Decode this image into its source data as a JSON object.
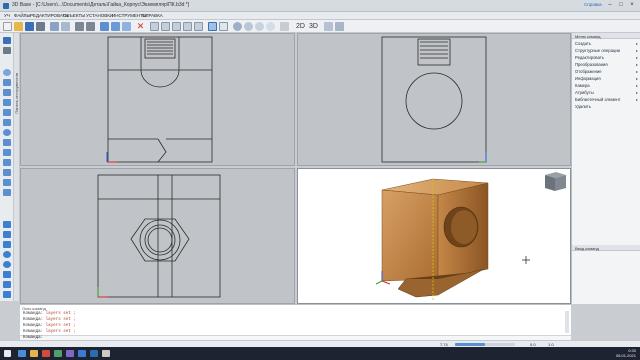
{
  "window": {
    "title": "3D Base - [C:\\Users\\...\\Documents\\Деталь\\Гайка_Корпус\\Экземпляр\\ПК.b3d *]",
    "help_link": "Справка",
    "min_glyph": "–",
    "max_glyph": "□",
    "close_glyph": "×"
  },
  "menu": [
    "УЧ",
    "ФАЙЛЫ",
    "РЕДАКТИРОВАТЬ",
    "ОБЪЕКТЫ",
    "УСТАНОВКИ",
    "ИНСТРУМЕНТЫ",
    "СПРАВКА"
  ],
  "toolbar": {
    "view_2d": "2D",
    "view_3d": "3D"
  },
  "side_tab": "Панель инструментов",
  "right_panel": {
    "menu_header": "Меню команд",
    "items": [
      "Создать",
      "Структурные операции",
      "Редактировать",
      "Преобразования",
      "Отображение",
      "Информация",
      "Камера",
      "Атрибуты",
      "Библиотечный элемент",
      "Удалить"
    ],
    "lower_header": "Ввод команд"
  },
  "command_panel": {
    "header": "Окно команд",
    "lines": [
      {
        "prefix": "Команда:",
        "text": "layers set ;"
      },
      {
        "prefix": "Команда:",
        "text": "layers set ;"
      },
      {
        "prefix": "Команда:",
        "text": "layers set ;"
      },
      {
        "prefix": "Команда:",
        "text": "layers set ;"
      }
    ],
    "prompt": "Команда:"
  },
  "status": {
    "zoom": "7.74",
    "coord": "0.0",
    "snap": "1.0"
  },
  "clock": {
    "time": "0:30",
    "date": "08.01.2021"
  },
  "colors": {
    "viewport_bg": "#c0c4c9",
    "active_viewport_bg": "#ffffff",
    "wood": "#c98f4e",
    "line": "#2a2a2a",
    "axis_red": "#d62828",
    "axis_blue": "#2d5bd7",
    "axis_green": "#2a9d2a"
  }
}
